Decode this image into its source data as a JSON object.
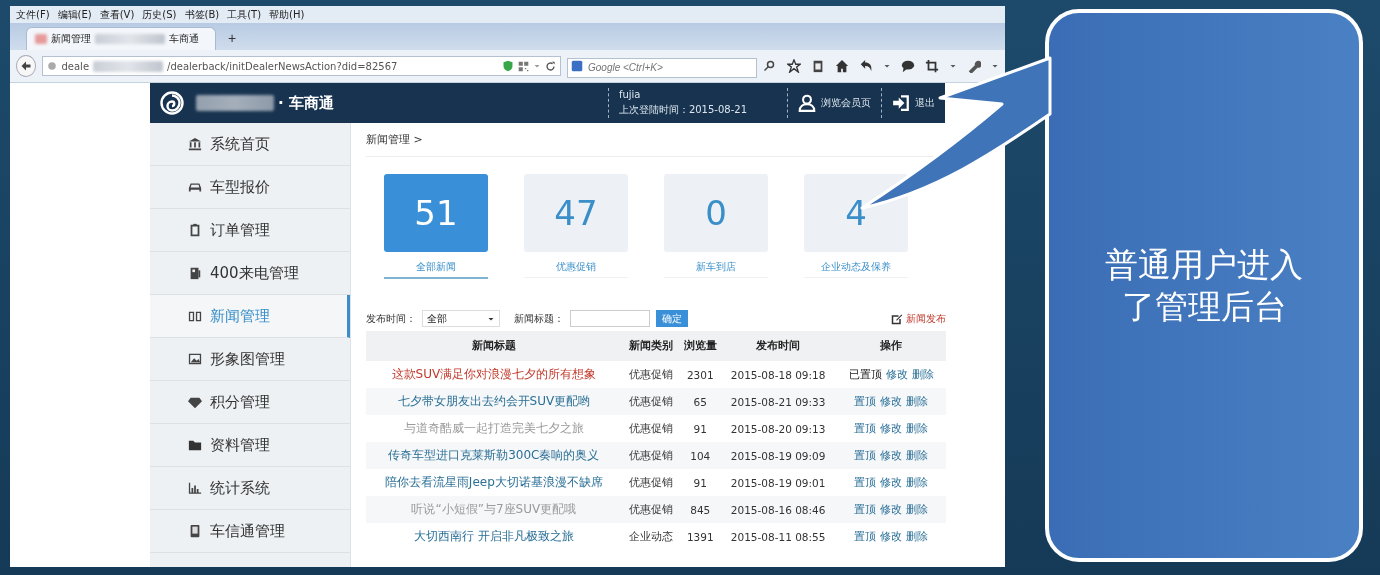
{
  "browser": {
    "menu": [
      "文件(F)",
      "编辑(E)",
      "查看(V)",
      "历史(S)",
      "书签(B)",
      "工具(T)",
      "帮助(H)"
    ],
    "tab": {
      "title_start": "新闻管理",
      "title_end": "车商通",
      "selected": true
    },
    "new_tab": "+",
    "url": {
      "start": "deale",
      "end": "/dealerback/initDealerNewsAction?did=82567"
    },
    "search": {
      "placeholder": "Google <Ctrl+K>"
    }
  },
  "app": {
    "brand": "· 车商通",
    "user": "fujia",
    "last_login": "上次登陆时间：2015-08-21",
    "member_link": "浏览会员页",
    "logout": "退出"
  },
  "sidebar": {
    "items": [
      {
        "label": "系统首页",
        "selected": false
      },
      {
        "label": "车型报价",
        "selected": false
      },
      {
        "label": "订单管理",
        "selected": false
      },
      {
        "label": "400来电管理",
        "selected": false
      },
      {
        "label": "新闻管理",
        "selected": true
      },
      {
        "label": "形象图管理",
        "selected": false
      },
      {
        "label": "积分管理",
        "selected": false
      },
      {
        "label": "资料管理",
        "selected": false
      },
      {
        "label": "统计系统",
        "selected": false
      },
      {
        "label": "车信通管理",
        "selected": false
      }
    ]
  },
  "breadcrumb": "新闻管理 >",
  "stats": [
    {
      "value": "51",
      "label": "全部新闻",
      "selected": true
    },
    {
      "value": "47",
      "label": "优惠促销",
      "selected": false
    },
    {
      "value": "0",
      "label": "新车到店",
      "selected": false
    },
    {
      "value": "4",
      "label": "企业动态及保养",
      "selected": false
    }
  ],
  "filter": {
    "time_label": "发布时间：",
    "time_value": "全部",
    "title_label": "新闻标题：",
    "submit": "确定",
    "publish": "新闻发布"
  },
  "table": {
    "columns": [
      "新闻标题",
      "新闻类别",
      "浏览量",
      "发布时间",
      "操作"
    ],
    "rows": [
      {
        "title": "这款SUV满足你对浪漫七夕的所有想象",
        "color": "#c0392b",
        "category": "优惠促销",
        "views": "2301",
        "time": "2015-08-18 09:18",
        "actions": [
          {
            "label": "已置顶",
            "kind": "text"
          },
          {
            "label": "修改",
            "kind": "link"
          },
          {
            "label": "删除",
            "kind": "link"
          }
        ]
      },
      {
        "title": "七夕带女朋友出去约会开SUV更配哟",
        "color": "#2a6f97",
        "category": "优惠促销",
        "views": "65",
        "time": "2015-08-21 09:33",
        "actions": [
          {
            "label": "置顶",
            "kind": "link"
          },
          {
            "label": "修改",
            "kind": "link"
          },
          {
            "label": "删除",
            "kind": "link"
          }
        ]
      },
      {
        "title": "与道奇酷威一起打造完美七夕之旅",
        "color": "#9a9a9a",
        "category": "优惠促销",
        "views": "91",
        "time": "2015-08-20 09:13",
        "actions": [
          {
            "label": "置顶",
            "kind": "link"
          },
          {
            "label": "修改",
            "kind": "link"
          },
          {
            "label": "删除",
            "kind": "link"
          }
        ]
      },
      {
        "title": "传奇车型进口克莱斯勒300C奏响的奥义",
        "color": "#2a6f97",
        "category": "优惠促销",
        "views": "104",
        "time": "2015-08-19 09:09",
        "actions": [
          {
            "label": "置顶",
            "kind": "link"
          },
          {
            "label": "修改",
            "kind": "link"
          },
          {
            "label": "删除",
            "kind": "link"
          }
        ]
      },
      {
        "title": "陪你去看流星雨Jeep大切诺基浪漫不缺席",
        "color": "#2a6f97",
        "category": "优惠促销",
        "views": "91",
        "time": "2015-08-19 09:01",
        "actions": [
          {
            "label": "置顶",
            "kind": "link"
          },
          {
            "label": "修改",
            "kind": "link"
          },
          {
            "label": "删除",
            "kind": "link"
          }
        ]
      },
      {
        "title": "听说“小短假”与7座SUV更配哦",
        "color": "#9a9a9a",
        "category": "优惠促销",
        "views": "845",
        "time": "2015-08-16 08:46",
        "actions": [
          {
            "label": "置顶",
            "kind": "link"
          },
          {
            "label": "修改",
            "kind": "link"
          },
          {
            "label": "删除",
            "kind": "link"
          }
        ]
      },
      {
        "title": "大切西南行 开启非凡极致之旅",
        "color": "#2a6f97",
        "category": "企业动态",
        "views": "1391",
        "time": "2015-08-11 08:55",
        "actions": [
          {
            "label": "置顶",
            "kind": "link"
          },
          {
            "label": "修改",
            "kind": "link"
          },
          {
            "label": "删除",
            "kind": "link"
          }
        ]
      }
    ]
  },
  "callout": {
    "text": "普通用户进入了管理后台"
  }
}
